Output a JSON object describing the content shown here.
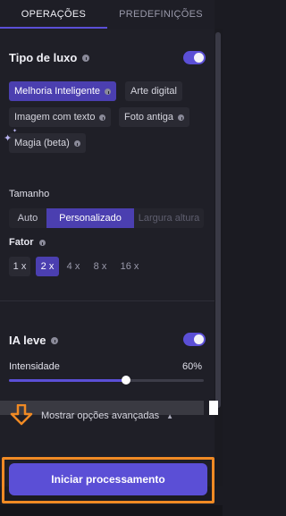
{
  "tabs": {
    "active": "OPERAÇÕES",
    "inactive": "PREDEFINIÇÕES"
  },
  "luxury_type": {
    "title": "Tipo de luxo",
    "enabled": true,
    "options": [
      "Melhoria Inteligente",
      "Arte digital",
      "Imagem com texto",
      "Foto antiga",
      "Magia (beta)"
    ],
    "selected": "Melhoria Inteligente"
  },
  "size": {
    "title": "Tamanho",
    "modes": [
      "Auto",
      "Personalizado",
      "Largura altura"
    ],
    "selected_mode": "Personalizado"
  },
  "factor": {
    "title": "Fator",
    "options": [
      "1 x",
      "2 x",
      "4 x",
      "8 x",
      "16 x"
    ],
    "selected": "2 x"
  },
  "light_ai": {
    "title": "IA leve",
    "enabled": true,
    "intensity_label": "Intensidade",
    "intensity_text": "60%",
    "intensity_value": 0.6
  },
  "advanced_label": "Mostrar opções avançadas",
  "start_button": "Iniciar processamento",
  "colors": {
    "accent": "#5b4fd6",
    "highlight": "#f08a24"
  }
}
